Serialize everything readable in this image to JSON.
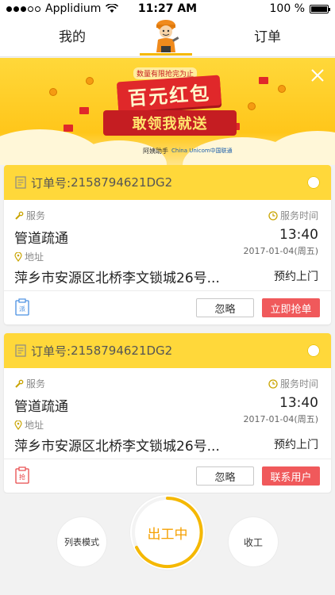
{
  "status_bar": {
    "carrier": "Applidium",
    "time": "11:27 AM",
    "battery": "100 %"
  },
  "nav": {
    "left_tab": "我的",
    "right_tab": "订单",
    "avatar": "worker-avatar-icon"
  },
  "banner": {
    "slogan": "数量有限抢完为止",
    "title": "百元红包",
    "subtitle": "敢领我就送",
    "brand_left": "阿姨助手",
    "brand_right": "China Unicom中国联通"
  },
  "orders": [
    {
      "order_label": "订单号:",
      "order_number": "2158794621DG2",
      "service_label": "服务",
      "service_value": "管道疏通",
      "time_label": "服务时间",
      "time_value": "13:40",
      "date_value": "2017-01-04(周五)",
      "address_label": "地址",
      "address_value": "萍乡市安源区北桥李文锁城26号...",
      "appointment": "预约上门",
      "tag": "派",
      "tag_color": "#4a90e2",
      "ignore_label": "忽略",
      "action_label": "立即抢单"
    },
    {
      "order_label": "订单号:",
      "order_number": "2158794621DG2",
      "service_label": "服务",
      "service_value": "管道疏通",
      "time_label": "服务时间",
      "time_value": "13:40",
      "date_value": "2017-01-04(周五)",
      "address_label": "地址",
      "address_value": "萍乡市安源区北桥李文锁城26号...",
      "appointment": "预约上门",
      "tag": "抢",
      "tag_color": "#e84a4c",
      "ignore_label": "忽略",
      "action_label": "联系用户"
    }
  ],
  "bottom": {
    "list_mode": "列表模式",
    "working": "出工中",
    "end_work": "收工"
  },
  "colors": {
    "accent_yellow": "#ffd83a",
    "action_red": "#f0595b",
    "working_orange": "#f5a000"
  }
}
